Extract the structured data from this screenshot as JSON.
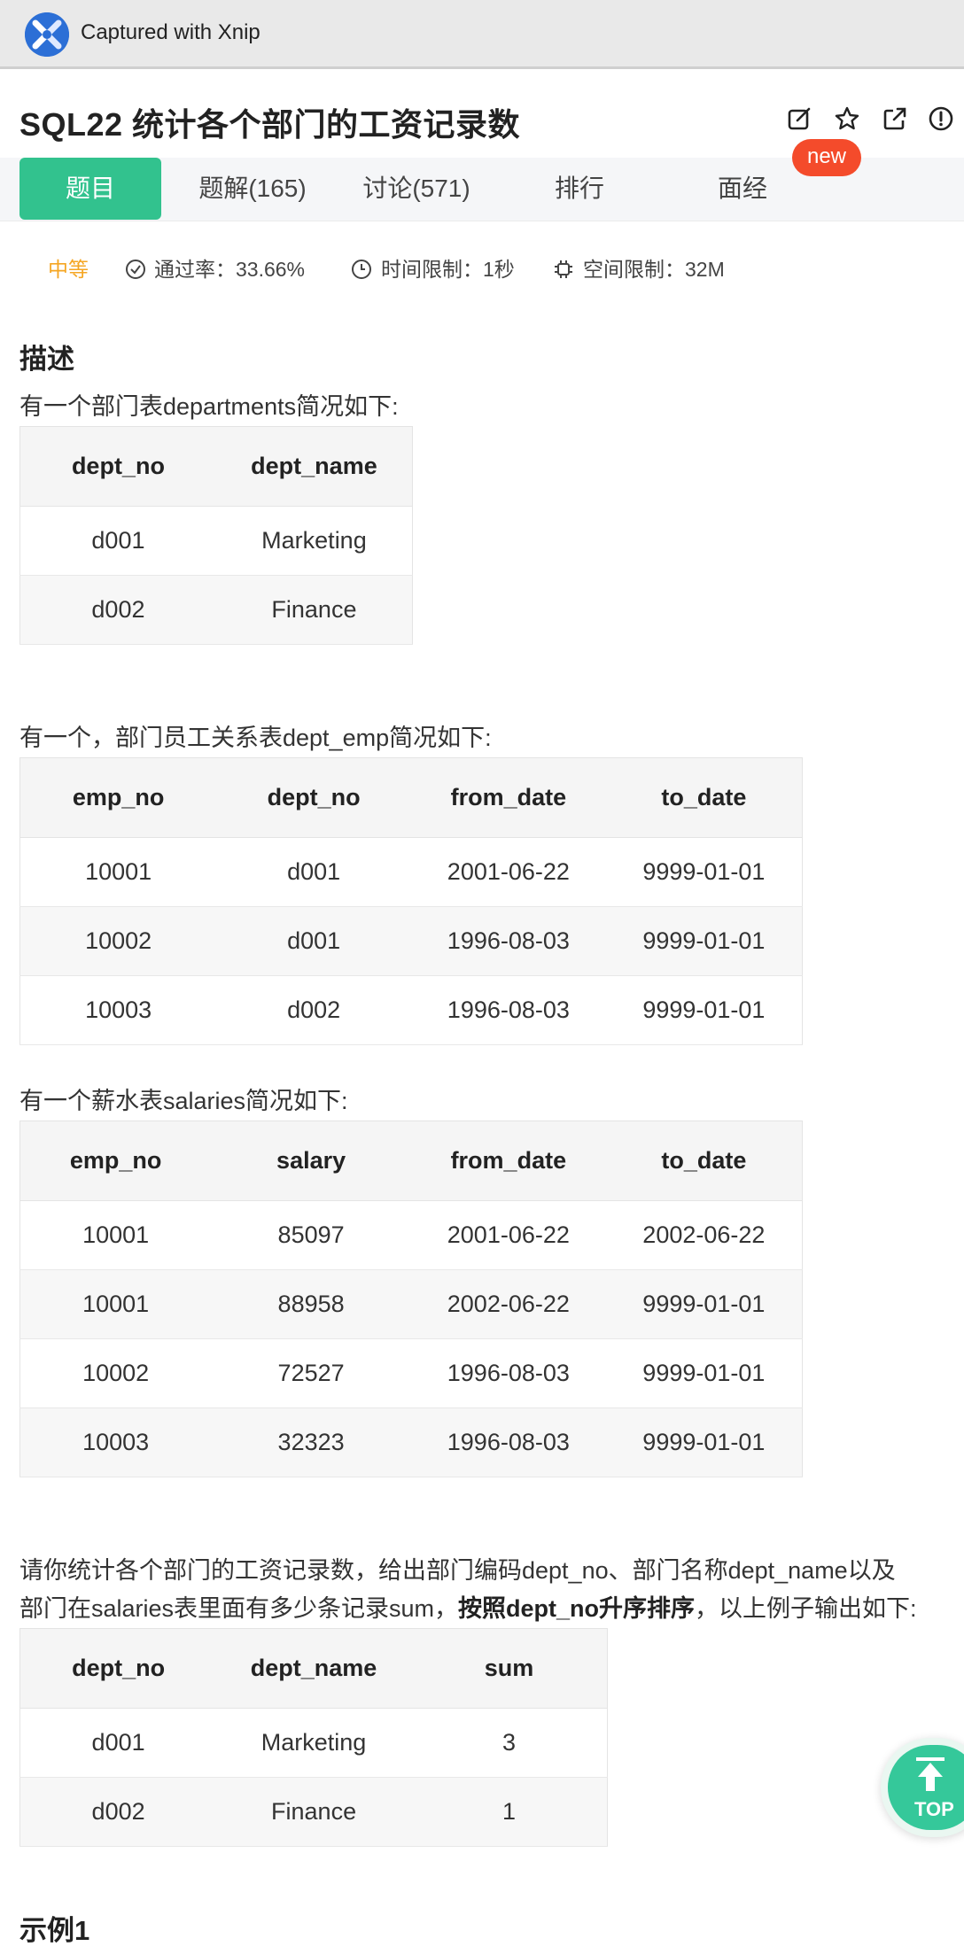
{
  "xnip": {
    "title": "Captured with Xnip"
  },
  "header": {
    "title": "SQL22  统计各个部门的工资记录数",
    "icons": [
      "edit-icon",
      "star-icon",
      "share-icon",
      "info-icon"
    ]
  },
  "tabs": [
    {
      "label": "题目",
      "active": true
    },
    {
      "label": "题解(165)"
    },
    {
      "label": "讨论(571)"
    },
    {
      "label": "排行"
    },
    {
      "label": "面经"
    }
  ],
  "new_badge": "new",
  "meta": {
    "level": "中等",
    "pass_rate": "通过率：33.66%",
    "time_limit": "时间限制：1秒",
    "space_limit": "空间限制：32M"
  },
  "description": {
    "heading": "描述",
    "intro_departments": "有一个部门表departments简况如下:",
    "departments": {
      "columns": [
        "dept_no",
        "dept_name"
      ],
      "rows": [
        [
          "d001",
          "Marketing"
        ],
        [
          "d002",
          "Finance"
        ]
      ]
    },
    "intro_dept_emp": "有一个，部门员工关系表dept_emp简况如下:",
    "dept_emp": {
      "columns": [
        "emp_no",
        "dept_no",
        "from_date",
        "to_date"
      ],
      "rows": [
        [
          "10001",
          "d001",
          "2001-06-22",
          "9999-01-01"
        ],
        [
          "10002",
          "d001",
          "1996-08-03",
          "9999-01-01"
        ],
        [
          "10003",
          "d002",
          "1996-08-03",
          "9999-01-01"
        ]
      ]
    },
    "intro_salaries": "有一个薪水表salaries简况如下:",
    "salaries": {
      "columns": [
        "emp_no",
        "salary",
        "from_date",
        "to_date"
      ],
      "rows": [
        [
          "10001",
          "85097",
          "2001-06-22",
          "2002-06-22"
        ],
        [
          "10001",
          "88958",
          "2002-06-22",
          "9999-01-01"
        ],
        [
          "10002",
          "72527",
          "1996-08-03",
          "9999-01-01"
        ],
        [
          "10003",
          "32323",
          "1996-08-03",
          "9999-01-01"
        ]
      ]
    },
    "task_line1": "请你统计各个部门的工资记录数，给出部门编码dept_no、部门名称dept_name以及",
    "task_line2_a": "部门在salaries表里面有多少条记录sum，",
    "task_line2_bold": "按照dept_no升序排序",
    "task_line2_b": "，以上例子输出如下:",
    "result": {
      "columns": [
        "dept_no",
        "dept_name",
        "sum"
      ],
      "rows": [
        [
          "d001",
          "Marketing",
          "3"
        ],
        [
          "d002",
          "Finance",
          "1"
        ]
      ]
    }
  },
  "example_heading": "示例1",
  "top_button": {
    "label": "TOP"
  }
}
